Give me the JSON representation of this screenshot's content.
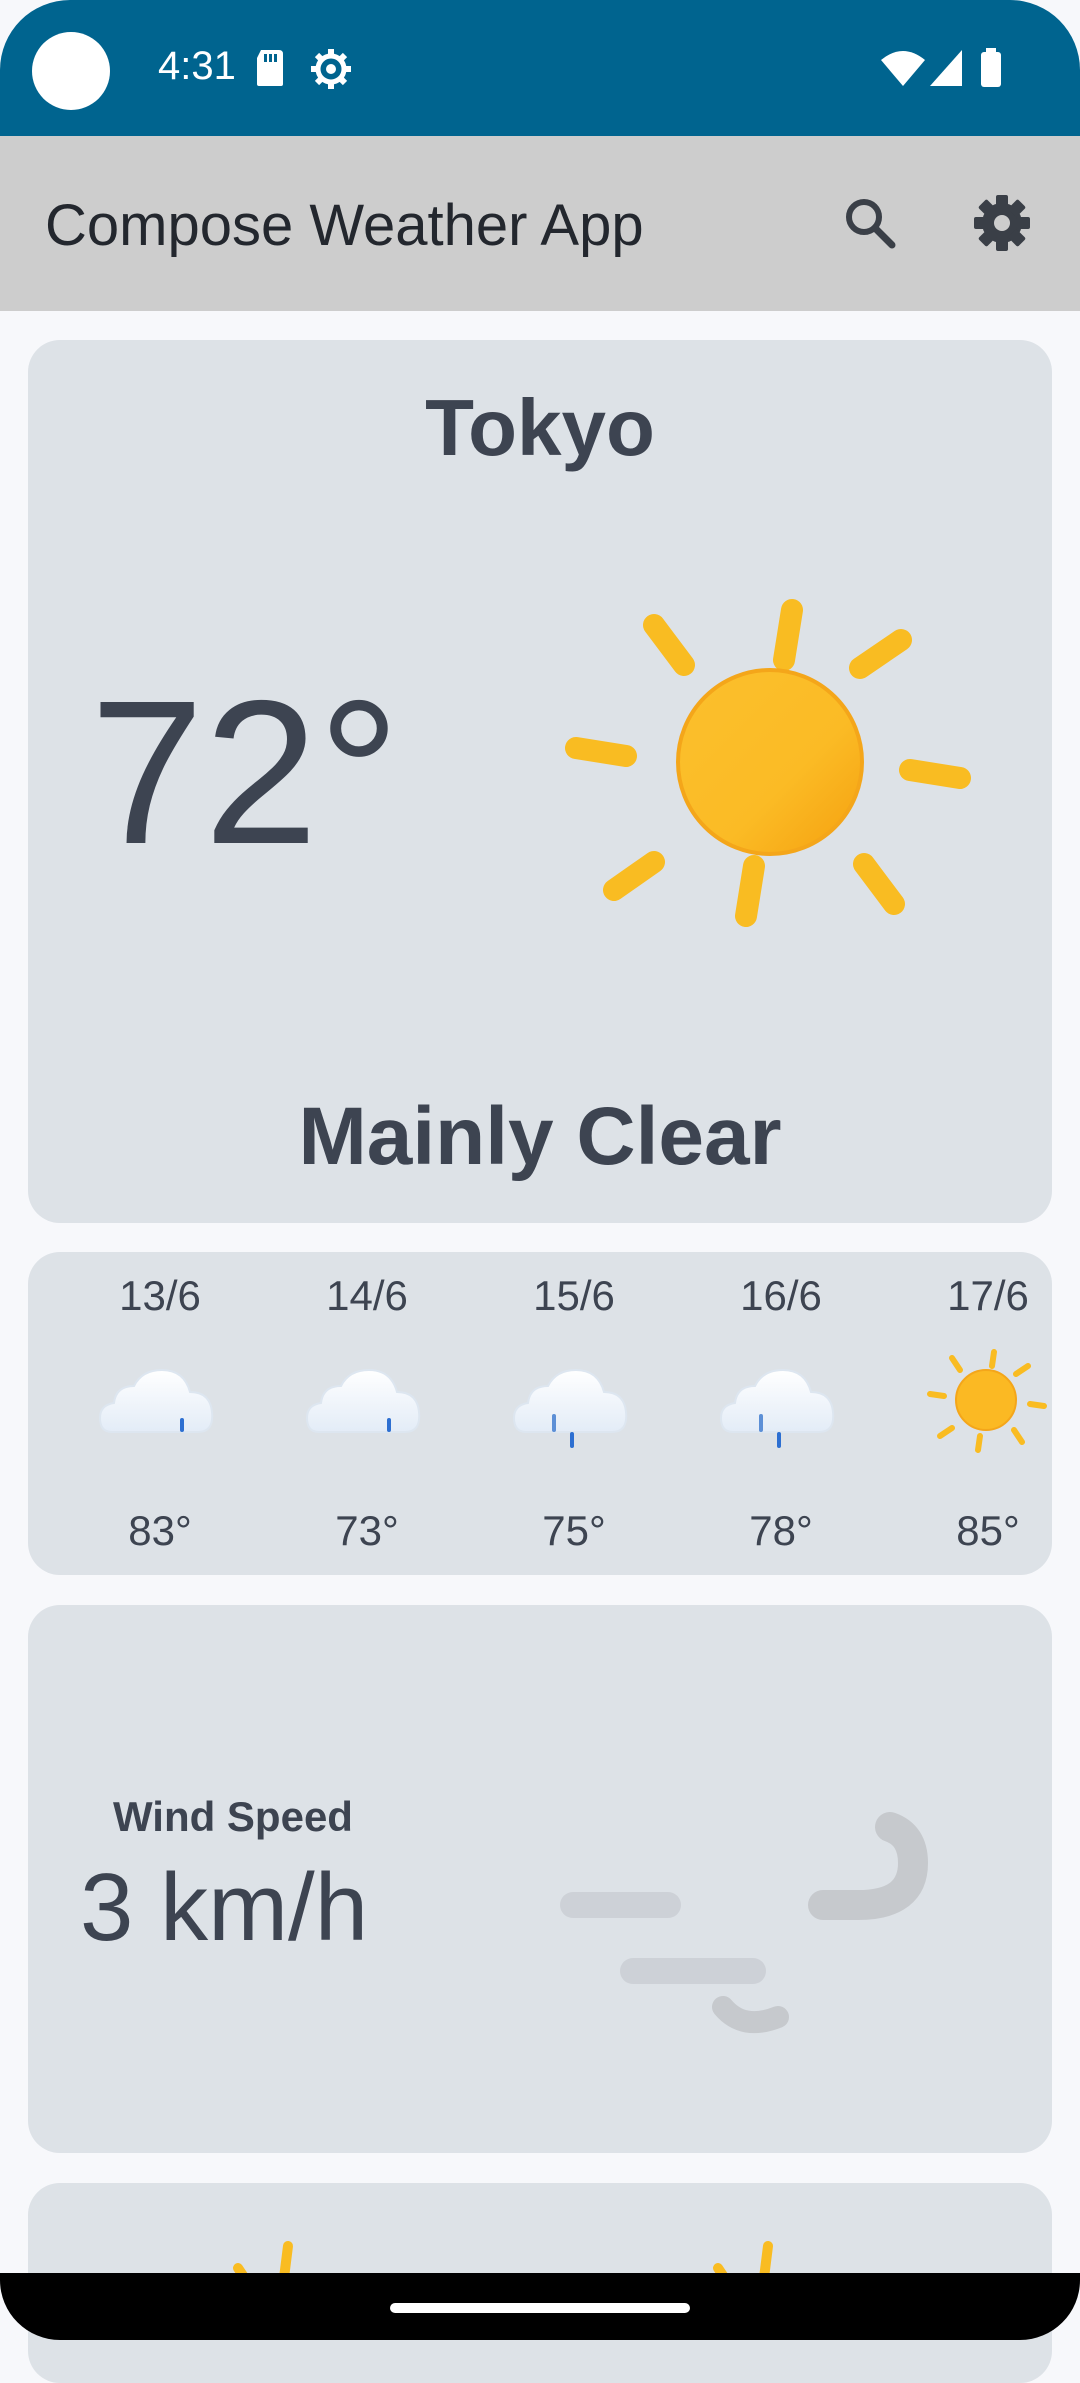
{
  "status_bar": {
    "time": "4:31",
    "icons": [
      "sd-card-icon",
      "settings-gear-icon",
      "wifi-icon",
      "signal-icon",
      "battery-icon"
    ],
    "background": "#00648f"
  },
  "app_bar": {
    "title": "Compose Weather App",
    "actions": [
      "search-icon",
      "settings-icon"
    ]
  },
  "current": {
    "city": "Tokyo",
    "temperature": "72°",
    "condition": "Mainly Clear",
    "icon": "sun-icon"
  },
  "forecast": [
    {
      "date": "13/6",
      "temp": "83°",
      "icon": "cloud-drizzle-icon"
    },
    {
      "date": "14/6",
      "temp": "73°",
      "icon": "cloud-drizzle-icon"
    },
    {
      "date": "15/6",
      "temp": "75°",
      "icon": "cloud-rain-icon"
    },
    {
      "date": "16/6",
      "temp": "78°",
      "icon": "cloud-rain-icon"
    },
    {
      "date": "17/6",
      "temp": "85°",
      "icon": "sun-icon"
    }
  ],
  "wind": {
    "label": "Wind Speed",
    "value": "3 km/h",
    "icon": "wind-icon"
  },
  "colors": {
    "accent": "#00648f",
    "card": "#dde2e7",
    "sun": "#f9bc22",
    "text": "#3d4451"
  }
}
